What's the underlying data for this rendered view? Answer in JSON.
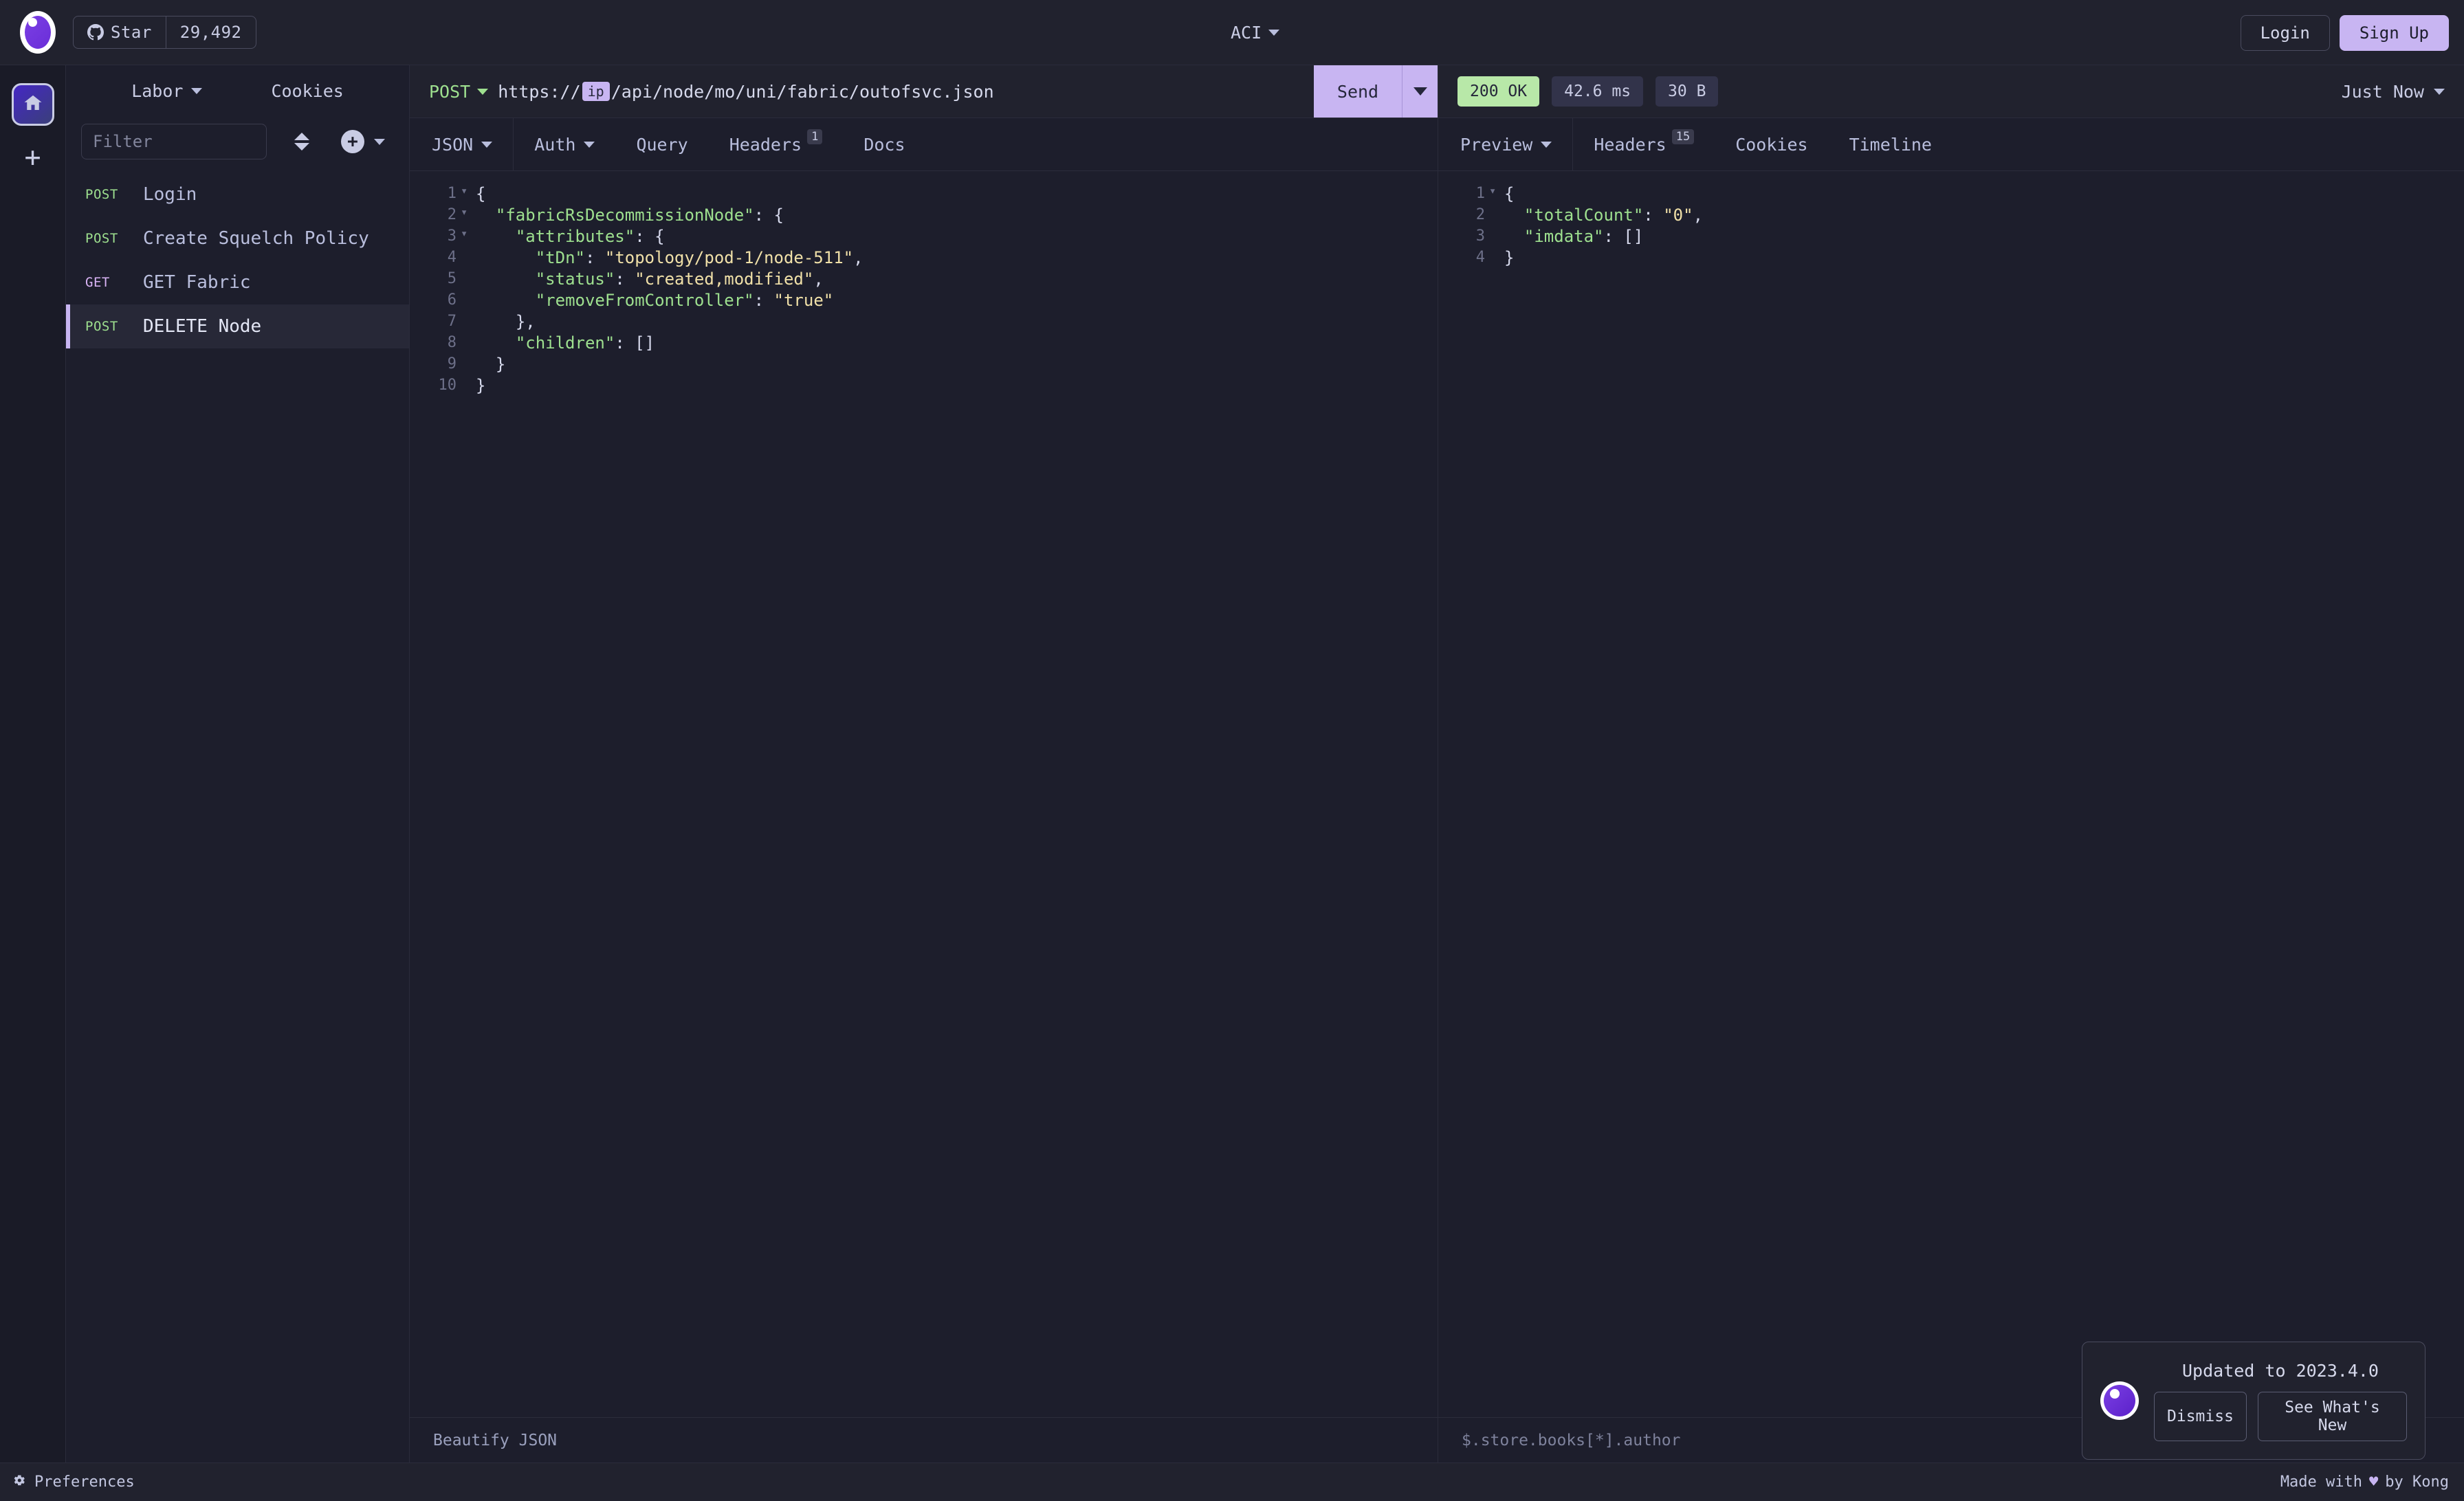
{
  "topbar": {
    "logo_icon": "insomnia-logo",
    "github": {
      "icon": "github-icon",
      "label": "Star",
      "count": "29,492"
    },
    "workspace": "ACI",
    "login_label": "Login",
    "signup_label": "Sign Up"
  },
  "rail": {
    "home_icon": "home-icon",
    "add_label": "+"
  },
  "sidebar": {
    "tabs": [
      {
        "label": "Labor",
        "caret": true
      },
      {
        "label": "Cookies",
        "caret": false
      }
    ],
    "filter_placeholder": "Filter",
    "sort_icon": "sort-icon",
    "add_icon": "plus-circle-icon",
    "requests": [
      {
        "method": "POST",
        "name": "Login",
        "active": false
      },
      {
        "method": "POST",
        "name": "Create Squelch Policy",
        "active": false
      },
      {
        "method": "GET",
        "name": "GET Fabric",
        "active": false
      },
      {
        "method": "POST",
        "name": "DELETE Node",
        "active": true
      }
    ]
  },
  "request": {
    "method": "POST",
    "url_prefix": "https://",
    "url_variable": "ip",
    "url_suffix": "/api/node/mo/uni/fabric/outofsvc.json",
    "send_label": "Send",
    "tabs": [
      {
        "label": "JSON",
        "caret": true,
        "badge": ""
      },
      {
        "label": "Auth",
        "caret": true,
        "badge": ""
      },
      {
        "label": "Query",
        "caret": false,
        "badge": ""
      },
      {
        "label": "Headers",
        "caret": false,
        "badge": "1"
      },
      {
        "label": "Docs",
        "caret": false,
        "badge": ""
      }
    ],
    "body_lines": [
      {
        "n": "1",
        "fold": "▾",
        "text": "{"
      },
      {
        "n": "2",
        "fold": "▾",
        "text": "  \"fabricRsDecommissionNode\": {"
      },
      {
        "n": "3",
        "fold": "▾",
        "text": "    \"attributes\": {"
      },
      {
        "n": "4",
        "fold": "",
        "text": "      \"tDn\": \"topology/pod-1/node-511\","
      },
      {
        "n": "5",
        "fold": "",
        "text": "      \"status\": \"created,modified\","
      },
      {
        "n": "6",
        "fold": "",
        "text": "      \"removeFromController\": \"true\""
      },
      {
        "n": "7",
        "fold": "",
        "text": "    },"
      },
      {
        "n": "8",
        "fold": "",
        "text": "    \"children\": []"
      },
      {
        "n": "9",
        "fold": "",
        "text": "  }"
      },
      {
        "n": "10",
        "fold": "",
        "text": "}"
      }
    ],
    "footer_label": "Beautify JSON"
  },
  "response": {
    "status_code": "200",
    "status_text": "OK",
    "time": "42.6 ms",
    "size": "30 B",
    "timestamp": "Just Now",
    "tabs": [
      {
        "label": "Preview",
        "caret": true,
        "badge": ""
      },
      {
        "label": "Headers",
        "caret": false,
        "badge": "15"
      },
      {
        "label": "Cookies",
        "caret": false,
        "badge": ""
      },
      {
        "label": "Timeline",
        "caret": false,
        "badge": ""
      }
    ],
    "body_lines": [
      {
        "n": "1",
        "fold": "▾",
        "text": "{"
      },
      {
        "n": "2",
        "fold": "",
        "text": "  \"totalCount\": \"0\","
      },
      {
        "n": "3",
        "fold": "",
        "text": "  \"imdata\": []"
      },
      {
        "n": "4",
        "fold": "",
        "text": "}"
      }
    ],
    "filter_placeholder": "$.store.books[*].author"
  },
  "statusbar": {
    "preferences_icon": "gear-icon",
    "preferences_label": "Preferences",
    "made_with_prefix": "Made with",
    "made_with_heart": "♥",
    "made_with_suffix": "by Kong"
  },
  "toast": {
    "logo_icon": "insomnia-logo",
    "message": "Updated to 2023.4.0",
    "dismiss_label": "Dismiss",
    "whatsnew_label": "See What's New"
  },
  "colors": {
    "accent": "#c8b5f2",
    "bg": "#1d1e2c",
    "panel": "#21222e",
    "success": "#b8e8a8",
    "method_post": "#9ee08f",
    "method_get": "#d9b3f5"
  }
}
